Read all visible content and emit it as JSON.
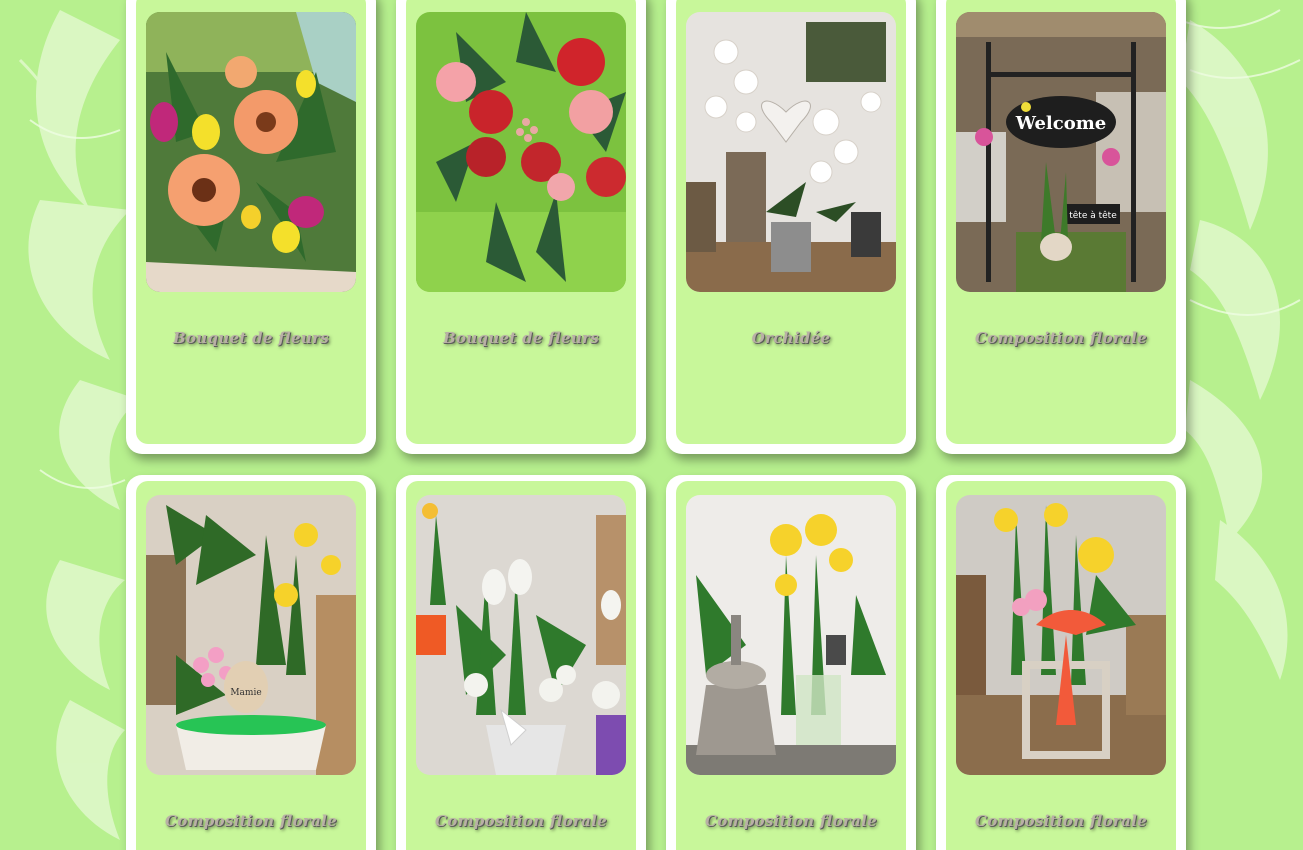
{
  "colors": {
    "background": "#b7f08e",
    "card_border": "#ffffff",
    "card_fill": "#c8f79a",
    "caption_text": "#b9b0a6"
  },
  "products": [
    {
      "title": "Bouquet de fleurs",
      "image": "orange-gerbera-bouquet"
    },
    {
      "title": "Bouquet de fleurs",
      "image": "red-roses-bouquet"
    },
    {
      "title": "Orchidée",
      "image": "white-orchid-pot"
    },
    {
      "title": "Composition florale",
      "image": "welcome-sign-hyacinth"
    },
    {
      "title": "Composition florale",
      "image": "daffodil-kalanchoe-planter"
    },
    {
      "title": "Composition florale",
      "image": "white-tulips-composition"
    },
    {
      "title": "Composition florale",
      "image": "daffodils-lantern"
    },
    {
      "title": "Composition florale",
      "image": "daffodils-wooden-lantern"
    }
  ],
  "photo_text": {
    "welcome": "Welcome",
    "tete": "tête à tête",
    "mamie": "Mamie"
  }
}
